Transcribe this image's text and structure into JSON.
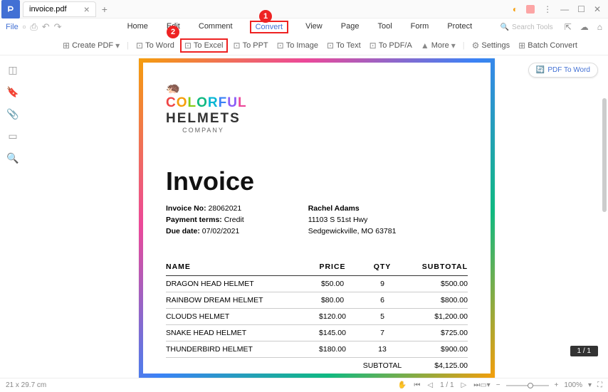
{
  "titlebar": {
    "tab_name": "invoice.pdf"
  },
  "menubar": {
    "file": "File",
    "items": [
      "Home",
      "Edit",
      "Comment",
      "Convert",
      "View",
      "Page",
      "Tool",
      "Form",
      "Protect"
    ],
    "search_placeholder": "Search Tools"
  },
  "callouts": {
    "c1": "1",
    "c2": "2"
  },
  "toolbar": {
    "create_pdf": "Create PDF",
    "to_word": "To Word",
    "to_excel": "To Excel",
    "to_ppt": "To PPT",
    "to_image": "To Image",
    "to_text": "To Text",
    "to_pdfa": "To PDF/A",
    "more": "More",
    "settings": "Settings",
    "batch": "Batch Convert"
  },
  "floating": {
    "pdf_to_word": "PDF To Word"
  },
  "doc": {
    "logo": {
      "line1": "COLORFUL",
      "line2": "HELMETS",
      "sub": "COMPANY"
    },
    "title": "Invoice",
    "info": {
      "invoice_no_label": "Invoice No:",
      "invoice_no": "28062021",
      "payment_label": "Payment terms:",
      "payment": "Credit",
      "due_label": "Due date:",
      "due": "07/02/2021",
      "name": "Rachel Adams",
      "addr1": "11103 S 51st Hwy",
      "addr2": "Sedgewickville, MO 63781"
    },
    "table": {
      "headers": {
        "name": "NAME",
        "price": "PRICE",
        "qty": "QTY",
        "sub": "SUBTOTAL"
      },
      "rows": [
        {
          "name": "DRAGON HEAD HELMET",
          "price": "$50.00",
          "qty": "9",
          "sub": "$500.00"
        },
        {
          "name": "RAINBOW DREAM HELMET",
          "price": "$80.00",
          "qty": "6",
          "sub": "$800.00"
        },
        {
          "name": "CLOUDS HELMET",
          "price": "$120.00",
          "qty": "5",
          "sub": "$1,200.00"
        },
        {
          "name": "SNAKE HEAD HELMET",
          "price": "$145.00",
          "qty": "7",
          "sub": "$725.00"
        },
        {
          "name": "THUNDERBIRD HELMET",
          "price": "$180.00",
          "qty": "13",
          "sub": "$900.00"
        }
      ],
      "subtotal_label": "SUBTOTAL",
      "subtotal": "$4,125.00"
    }
  },
  "statusbar": {
    "dims": "21 x 29.7 cm",
    "page": "1",
    "pages": "1",
    "page_display": "1 / 1",
    "zoom": "100%",
    "page_badge": "1 / 1"
  }
}
